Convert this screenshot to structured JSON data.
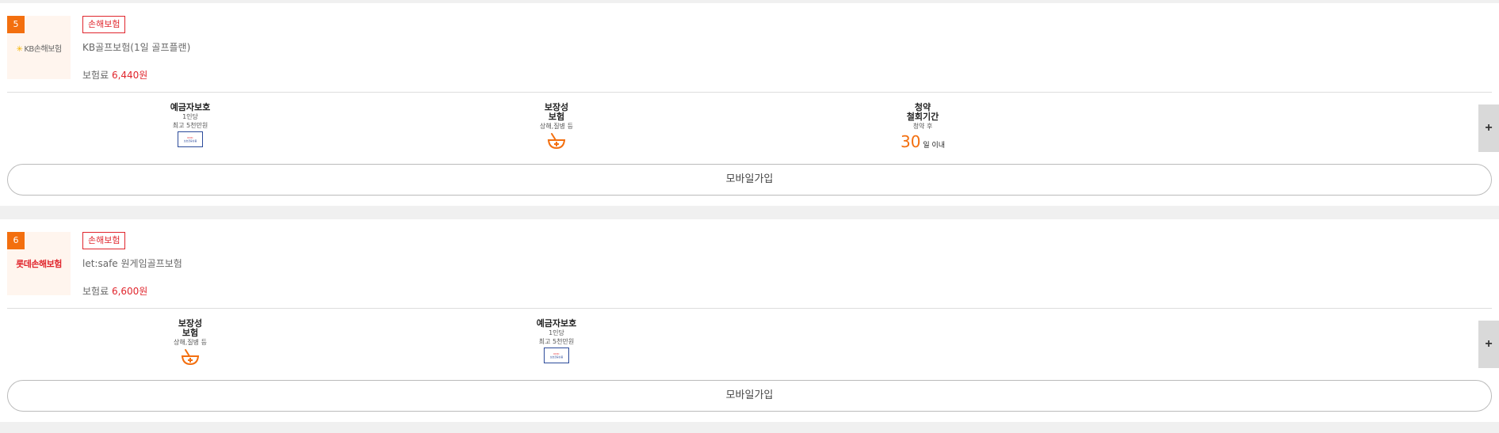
{
  "products": [
    {
      "rank": "5",
      "logo_text": "KB손해보험",
      "category_tag": "손해보험",
      "name": "KB골프보험(1일 골프플랜)",
      "price_label": "보험료",
      "price_value": "6,440원",
      "features": [
        {
          "title_line1": "예금자보호",
          "title_line2": "",
          "sub1": "1인당",
          "sub2": "최고 5천만원",
          "icon": "kdic-logo-icon"
        },
        {
          "title_line1": "보장성",
          "title_line2": "보험",
          "sub1": "상해,질병 등",
          "sub2": "",
          "icon": "medicine-bowl-icon"
        },
        {
          "title_line1": "청약",
          "title_line2": "철회기간",
          "sub1": "청약 후",
          "sub2": "",
          "days_num": "30",
          "days_unit": "일 이내"
        }
      ],
      "expand_label": "+",
      "mobile_join_label": "모바일가입"
    },
    {
      "rank": "6",
      "logo_text": "롯데손해보험",
      "category_tag": "손해보험",
      "name": "let:safe 원게임골프보험",
      "price_label": "보험료",
      "price_value": "6,600원",
      "features": [
        {
          "title_line1": "보장성",
          "title_line2": "보험",
          "sub1": "상해,질병 등",
          "sub2": "",
          "icon": "medicine-bowl-icon"
        },
        {
          "title_line1": "예금자보호",
          "title_line2": "",
          "sub1": "1인당",
          "sub2": "최고 5천만원",
          "icon": "kdic-logo-icon"
        }
      ],
      "expand_label": "+",
      "mobile_join_label": "모바일가입"
    }
  ],
  "kdic": {
    "line1": "KDIC",
    "line2": "보호금융상품"
  },
  "colors": {
    "accent_orange": "#f36f0f",
    "accent_red": "#e0262d",
    "kdic_blue": "#2b4a9a"
  }
}
